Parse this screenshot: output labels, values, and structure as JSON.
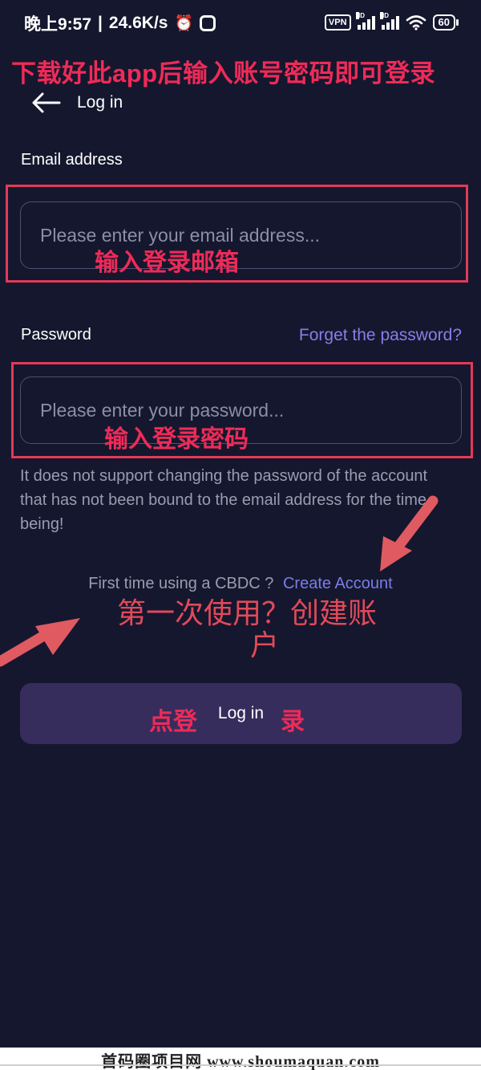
{
  "status_bar": {
    "time": "晚上9:57",
    "speed": "24.6K/s",
    "vpn": "VPN",
    "hd": "HD",
    "battery": "60"
  },
  "annotations": {
    "banner": "下载好此app后输入账号密码即可登录",
    "email_note": "输入登录邮箱",
    "password_note": "输入登录密码",
    "create_note_line1": "第一次使用？创建账",
    "create_note_line2": "户",
    "login_note_left": "点登",
    "login_note_right": "录"
  },
  "header": {
    "title": "Log in"
  },
  "form": {
    "email_label": "Email address",
    "email_placeholder": "Please enter your email address...",
    "password_label": "Password",
    "forget_link": "Forget the password?",
    "password_placeholder": "Please enter your password...",
    "hint": "It does not support changing the password of the account that has not been bound to the email address for the time being!",
    "first_time_text": "First time using a CBDC ?",
    "create_account_link": "Create Account",
    "login_button": "Log in"
  },
  "watermark": "首码圈项目网 www.shoumaquan.com",
  "colors": {
    "background": "#15172e",
    "accent_link": "#8c7ce8",
    "button": "#362d5d",
    "annotation_red": "#ee2b58"
  }
}
